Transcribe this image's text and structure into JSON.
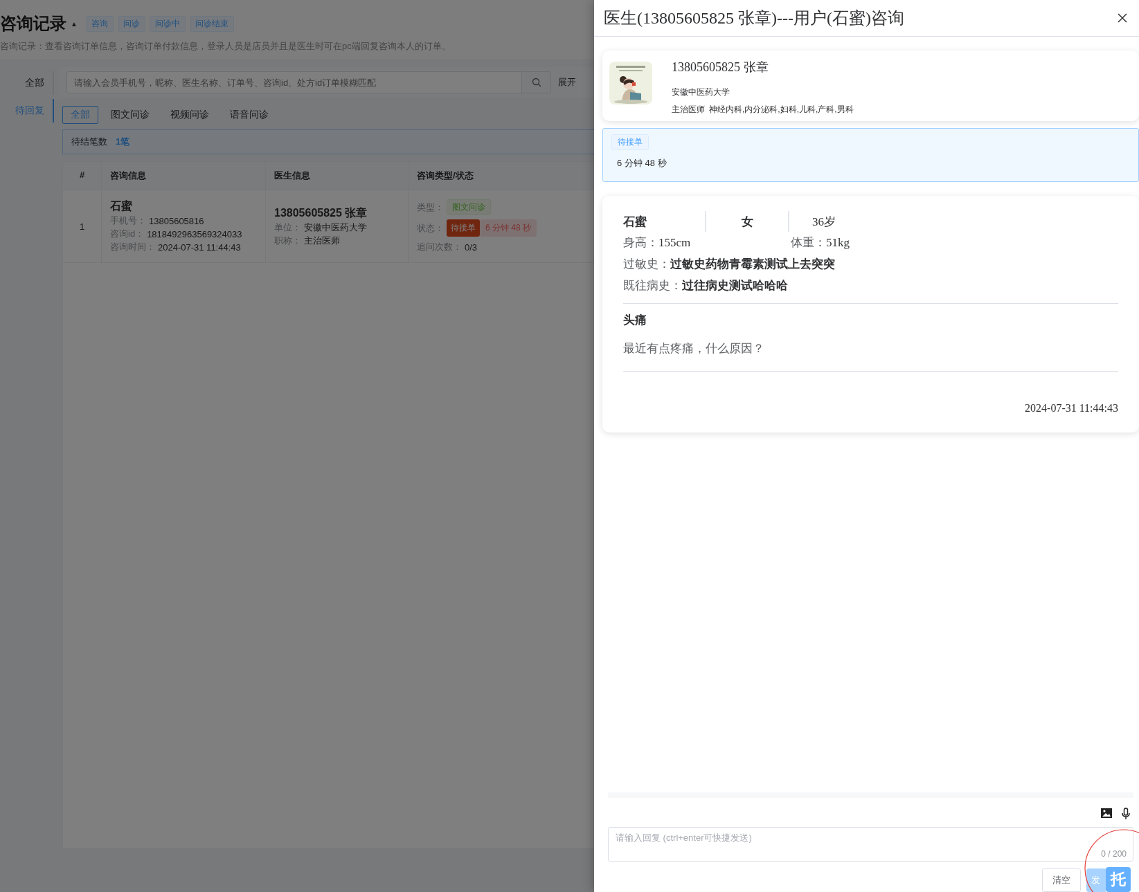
{
  "page": {
    "title": "咨询记录",
    "title_toggle": "▲",
    "filter_tags": [
      {
        "label": "咨询"
      },
      {
        "label": "问诊"
      },
      {
        "label": "问诊中"
      },
      {
        "label": "问诊结束"
      }
    ],
    "description": "咨询记录：查看咨询订单信息，咨询订单付款信息，登录人员是店员并且是医生时可在pc端回复咨询本人的订单。"
  },
  "side_tabs": [
    {
      "label": "全部",
      "selected": false
    },
    {
      "label": "待回复",
      "selected": true
    }
  ],
  "search": {
    "placeholder": "请输入会员手机号，昵称、医生名称、订单号、咨询id、处方id订单模糊匹配",
    "expand": "展开"
  },
  "type_tabs": [
    {
      "label": "全部",
      "selected": true
    },
    {
      "label": "图文问诊",
      "selected": false
    },
    {
      "label": "视频问诊",
      "selected": false
    },
    {
      "label": "语音问诊",
      "selected": false
    }
  ],
  "summary": {
    "label": "待结笔数",
    "value": "1笔"
  },
  "table": {
    "columns": [
      "#",
      "咨询信息",
      "医生信息",
      "咨询类型/状态"
    ],
    "rows": [
      {
        "index": "1",
        "user_name": "石蜜",
        "user_fields": [
          {
            "label": "手机号：",
            "value": "13805605816"
          },
          {
            "label": "咨询id：",
            "value": "1818492963569324033"
          },
          {
            "label": "咨询时间：",
            "value": "2024-07-31 11:44:43"
          }
        ],
        "doctor_name": "13805605825 张章",
        "doctor_fields": [
          {
            "label": "单位：",
            "value": "安徽中医药大学"
          },
          {
            "label": "职称：",
            "value": "主治医师"
          }
        ],
        "type_label": "类型：",
        "type": "图文问诊",
        "status_label": "状态：",
        "status": "待接单",
        "timer": "6 分钟 48 秒",
        "followup_label": "追问次数：",
        "followup": "0/3"
      }
    ]
  },
  "drawer": {
    "title": "医生(13805605825 张章)---用户(石蜜)咨询",
    "doctor": {
      "name": "13805605825 张章",
      "org": "安徽中医药大学",
      "title": "主治医师",
      "departments": "神经内科,内分泌科,妇科,儿科,产科,男科"
    },
    "state": {
      "tag": "待接单",
      "elapsed": "6 分钟 48 秒"
    },
    "patient": {
      "name": "石蜜",
      "gender": "女",
      "age": "36岁",
      "height_label": "身高：",
      "height": "155cm",
      "weight_label": "体重：",
      "weight": "51kg",
      "allergy_label": "过敏史：",
      "allergy": "过敏史药物青霉素测试上去突突",
      "history_label": "既往病史：",
      "history": "过往病史测试哈哈哈"
    },
    "question": {
      "title": "头痛",
      "body": "最近有点疼痛，什么原因？",
      "time": "2024-07-31 11:44:43"
    },
    "reply": {
      "placeholder": "请输入回复 (ctrl+enter可快捷发送)",
      "counter": "0 / 200",
      "buttons": [
        {
          "label": "清空",
          "kind": "default",
          "disabled": false
        },
        {
          "label": "发",
          "kind": "primary",
          "disabled": true
        }
      ],
      "float_badge": "托"
    }
  }
}
